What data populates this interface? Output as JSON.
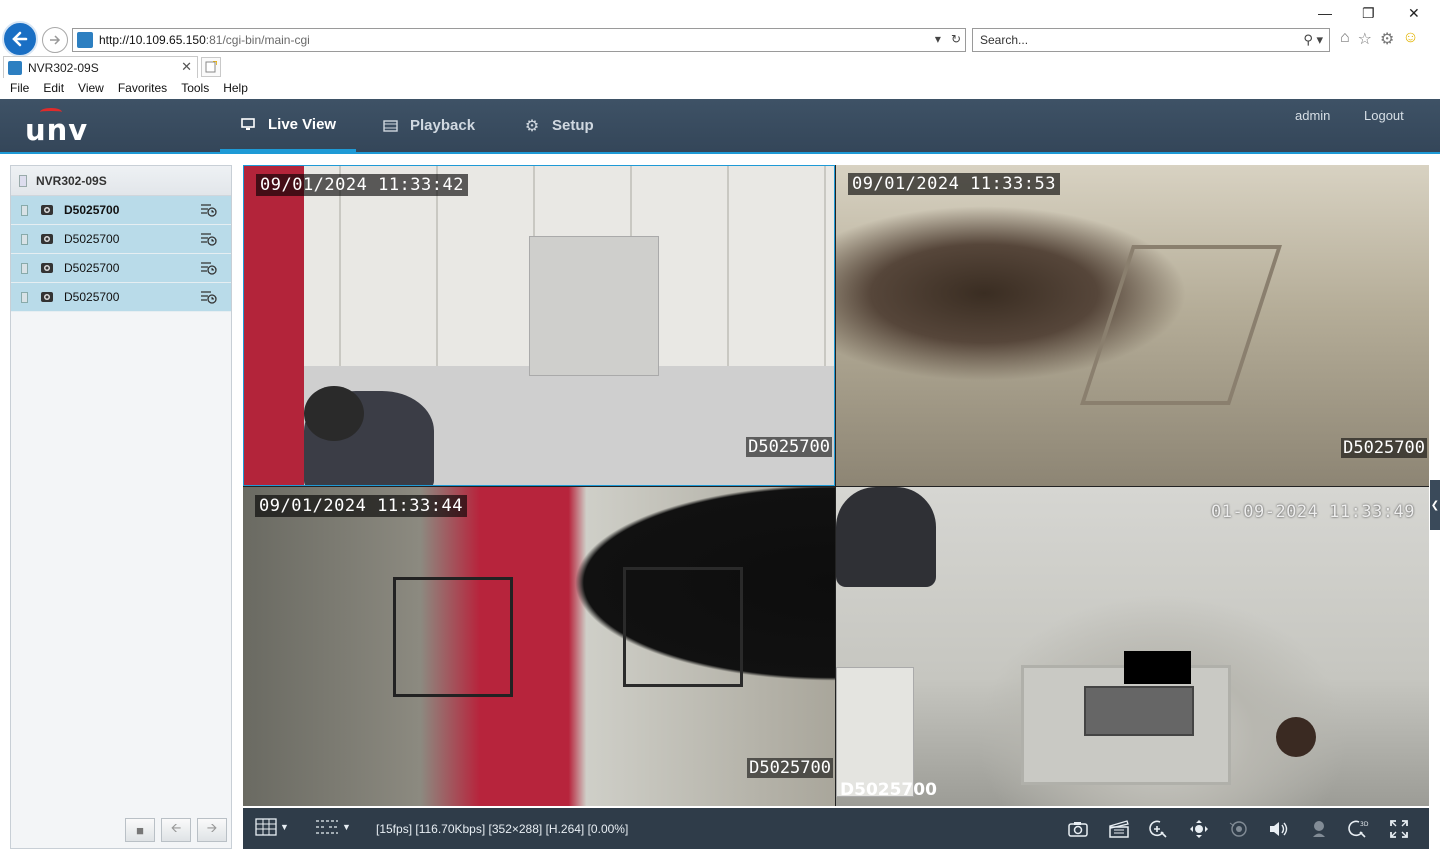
{
  "browser": {
    "url_host": "http://10.109.65.150",
    "url_rest": ":81/cgi-bin/main-cgi",
    "search_placeholder": "Search...",
    "tab_title": "NVR302-09S",
    "menu": [
      "File",
      "Edit",
      "View",
      "Favorites",
      "Tools",
      "Help"
    ]
  },
  "app": {
    "logo": "unv",
    "nav": {
      "live_view": "Live View",
      "playback": "Playback",
      "setup": "Setup"
    },
    "user": "admin",
    "logout": "Logout",
    "accent_color": "#1e9ad6",
    "header_color": "#3e5266"
  },
  "sidebar": {
    "device": "NVR302-09S",
    "cameras": [
      {
        "name": "D5025700",
        "selected": true
      },
      {
        "name": "D5025700",
        "selected": false
      },
      {
        "name": "D5025700",
        "selected": false
      },
      {
        "name": "D5025700",
        "selected": false
      }
    ]
  },
  "tiles": [
    {
      "timestamp": "09/01/2024 11:33:42",
      "camera": "D5025700"
    },
    {
      "timestamp": "09/01/2024 11:33:53",
      "camera": "D5025700"
    },
    {
      "timestamp": "09/01/2024 11:33:44",
      "camera": "D5025700"
    },
    {
      "timestamp": "01-09-2024 11:33:49",
      "camera": "D5025700"
    }
  ],
  "toolbar": {
    "status": "[15fps] [116.70Kbps] [352×288] [H.264] [0.00%]"
  }
}
